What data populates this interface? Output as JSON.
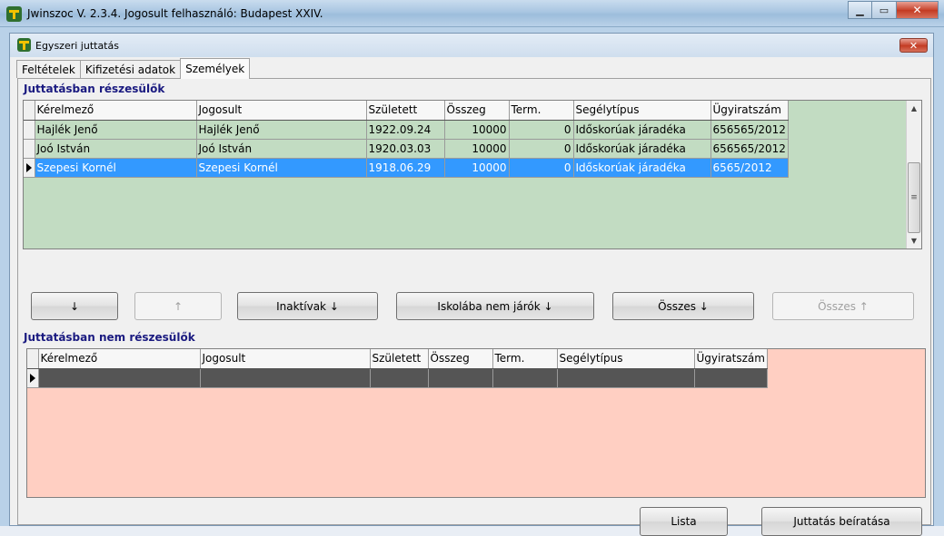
{
  "app": {
    "title": "Jwinszoc V. 2.3.4.  Jogosult felhasználó: Budapest XXIV.",
    "minimize": "▁",
    "maximize": "▭",
    "close": "✕"
  },
  "dialog": {
    "title": "Egyszeri juttatás",
    "close": "✕"
  },
  "tabs": [
    {
      "label": "Feltételek"
    },
    {
      "label": "Kifizetési adatok"
    },
    {
      "label": "Személyek"
    }
  ],
  "included": {
    "label": "Juttatásban részesülők",
    "columns": [
      "Kérelmező",
      "Jogosult",
      "Született",
      "Összeg",
      "Term.",
      "Segélytípus",
      "Ügyiratszám"
    ],
    "rows": [
      [
        "Hajlék Jenő",
        "Hajlék Jenő",
        "1922.09.24",
        "10000",
        "0",
        "Időskorúak járadéka",
        "656565/2012"
      ],
      [
        "Joó István",
        "Joó István",
        "1920.03.03",
        "10000",
        "0",
        "Időskorúak járadéka",
        "656565/2012"
      ],
      [
        "Szepesi Kornél",
        "Szepesi Kornél",
        "1918.06.29",
        "10000",
        "0",
        "Időskorúak járadéka",
        "6565/2012"
      ]
    ],
    "selected_row": 2
  },
  "transfer_buttons": {
    "down": "↓",
    "up": "↑",
    "inactive": "Inaktívak ↓",
    "not_in_school": "Iskolába nem járók ↓",
    "all_down": "Összes ↓",
    "all_up": "Összes ↑"
  },
  "excluded": {
    "label": "Juttatásban nem részesülők",
    "columns": [
      "Kérelmező",
      "Jogosult",
      "Született",
      "Összeg",
      "Term.",
      "Segélytípus",
      "Ügyiratszám"
    ],
    "rows": [
      [
        "",
        "",
        "",
        "",
        "",
        "",
        ""
      ]
    ]
  },
  "footer_buttons": {
    "list": "Lista",
    "submit": "Juttatás beíratása"
  },
  "colors": {
    "included_bg": "#c2dcc2",
    "excluded_bg": "#ffcfc2",
    "selection": "#3399ff",
    "section_label": "#1a1a80"
  }
}
